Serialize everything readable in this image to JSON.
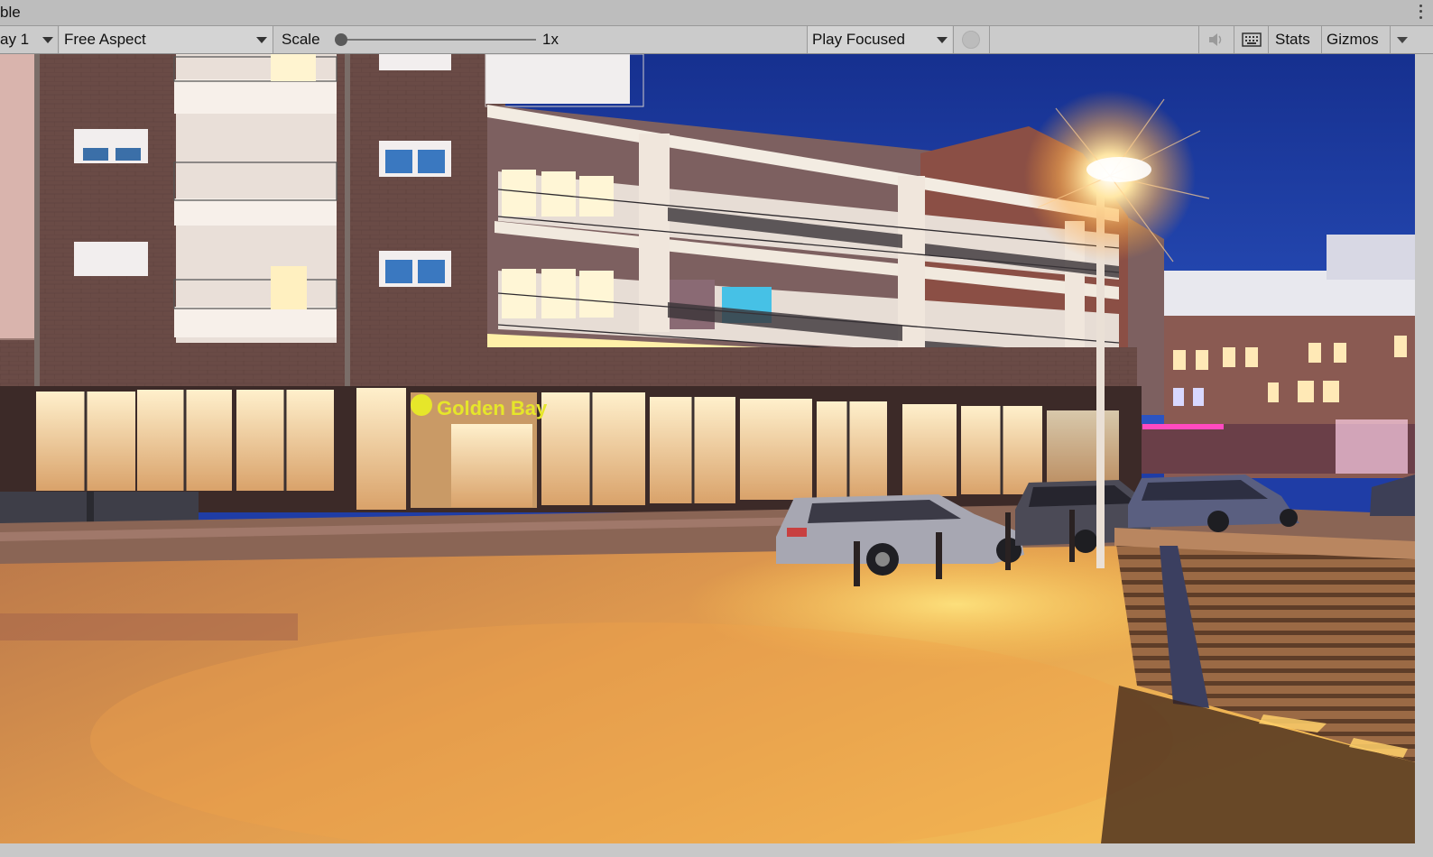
{
  "window": {
    "title": "ble"
  },
  "toolbar": {
    "display_label": "ay 1",
    "aspect_label": "Free Aspect",
    "scale_label": "Scale",
    "scale_value": "1x",
    "scale_fraction": 0.0,
    "play_mode_label": "Play Focused",
    "stats_label": "Stats",
    "gizmos_label": "Gizmos"
  },
  "icons": {
    "menu": "kebab-menu-icon",
    "bug": "bug-icon",
    "mute": "speaker-mute-icon",
    "keyboard": "keyboard-icon",
    "dropdown": "chevron-down-icon"
  },
  "scene": {
    "sign_text": "Golden Bay",
    "colors": {
      "sky": "#1f3da6",
      "ground": "#e6973f",
      "brick": "#6b4a44",
      "window_glow": "#ffe4b0",
      "sign": "#e6e62a"
    }
  }
}
